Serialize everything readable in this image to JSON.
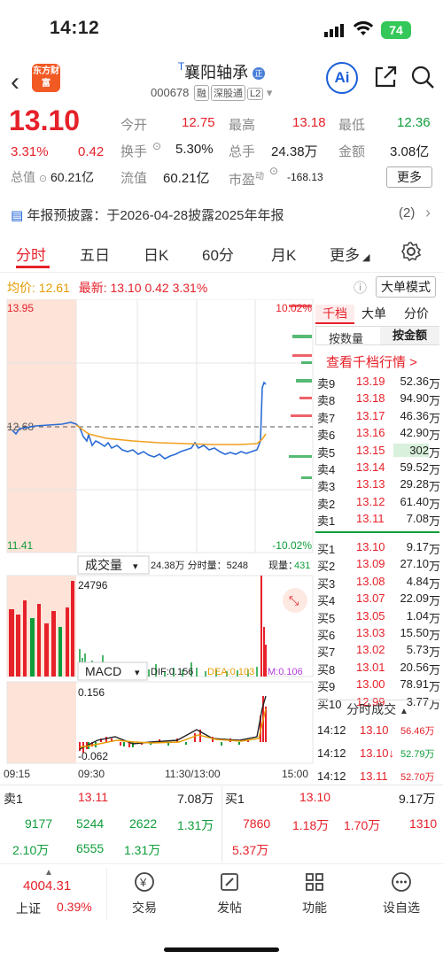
{
  "status": {
    "time": "14:12",
    "battery": "74"
  },
  "header": {
    "logo": "东方财富",
    "title": "襄阳轴承",
    "title_prefix": "T",
    "code": "000678",
    "tags": [
      "融",
      "深股通",
      "L2"
    ],
    "ai": "Ai"
  },
  "quote": {
    "price": "13.10",
    "pct": "3.31%",
    "chg": "0.42",
    "open_label": "今开",
    "open": "12.75",
    "high_label": "最高",
    "high": "13.18",
    "low_label": "最低",
    "low": "12.36",
    "turnover_label": "换手",
    "turnover": "5.30%",
    "vol_label": "总手",
    "vol": "24.38万",
    "amount_label": "金额",
    "amount": "3.08亿",
    "mcap_label": "总值",
    "mcap": "60.21亿",
    "float_label": "流值",
    "float": "60.21亿",
    "pe_label": "市盈",
    "pe_sup": "动",
    "pe": "-168.13",
    "more": "更多"
  },
  "notice": {
    "text": "年报预披露：于2026-04-28披露2025年年报",
    "count": "(2)"
  },
  "tabs": [
    "分时",
    "五日",
    "日K",
    "60分",
    "月K",
    "更多"
  ],
  "info": {
    "avg_label": "均价:",
    "avg": "12.61",
    "last_label": "最新:",
    "last": "13.10",
    "chg": "0.42",
    "pct": "3.31%",
    "big_order": "大单模式"
  },
  "chart": {
    "y_top": "13.95",
    "y_bottom": "11.41",
    "pct_top": "10.02%",
    "pct_bottom": "-10.02%",
    "ref": "12.68",
    "vol_label": "成交量",
    "vol_info": "24.38万 分时量：5248",
    "vol_now_label": "现量：",
    "vol_now": "431",
    "vol_max": "24796",
    "macd_label": "MACD",
    "dif": "DIF:0.156",
    "dea": "DEA:0.103",
    "m": "M:0.106",
    "macd_top": "0.156",
    "macd_bottom": "-0.062",
    "times": [
      "09:15",
      "09:30",
      "11:30/13:00",
      "15:00"
    ]
  },
  "orderbook": {
    "tabs": [
      "千档",
      "大单",
      "分价"
    ],
    "subtabs": [
      "按数量",
      "按金额"
    ],
    "link": "查看千档行情 >",
    "asks": [
      {
        "l": "卖9",
        "p": "13.19",
        "v": "52.36",
        "u": "万"
      },
      {
        "l": "卖8",
        "p": "13.18",
        "v": "94.90",
        "u": "万"
      },
      {
        "l": "卖7",
        "p": "13.17",
        "v": "46.36",
        "u": "万"
      },
      {
        "l": "卖6",
        "p": "13.16",
        "v": "42.90",
        "u": "万"
      },
      {
        "l": "卖5",
        "p": "13.15",
        "v": "302",
        "u": "万"
      },
      {
        "l": "卖4",
        "p": "13.14",
        "v": "59.52",
        "u": "万"
      },
      {
        "l": "卖3",
        "p": "13.13",
        "v": "29.28",
        "u": "万"
      },
      {
        "l": "卖2",
        "p": "13.12",
        "v": "61.40",
        "u": "万"
      },
      {
        "l": "卖1",
        "p": "13.11",
        "v": "7.08",
        "u": "万"
      }
    ],
    "bids": [
      {
        "l": "买1",
        "p": "13.10",
        "v": "9.17",
        "u": "万"
      },
      {
        "l": "买2",
        "p": "13.09",
        "v": "27.10",
        "u": "万"
      },
      {
        "l": "买3",
        "p": "13.08",
        "v": "4.84",
        "u": "万"
      },
      {
        "l": "买4",
        "p": "13.07",
        "v": "22.09",
        "u": "万"
      },
      {
        "l": "买5",
        "p": "13.05",
        "v": "1.04",
        "u": "万"
      },
      {
        "l": "买6",
        "p": "13.03",
        "v": "15.50",
        "u": "万"
      },
      {
        "l": "买7",
        "p": "13.02",
        "v": "5.73",
        "u": "万"
      },
      {
        "l": "买8",
        "p": "13.01",
        "v": "20.56",
        "u": "万"
      },
      {
        "l": "买9",
        "p": "13.00",
        "v": "78.91",
        "u": "万"
      },
      {
        "l": "买10",
        "p": "12.99",
        "v": "3.77",
        "u": "万"
      }
    ],
    "trades_title": "分时成交",
    "trades": [
      {
        "t": "14:12",
        "p": "13.10",
        "v": "56.46万"
      },
      {
        "t": "14:12",
        "p": "13.10↓",
        "v": "52.79万"
      },
      {
        "t": "14:12",
        "p": "13.11",
        "v": "52.70万"
      }
    ]
  },
  "depth": {
    "ask_label": "卖1",
    "ask_price": "13.11",
    "ask_vol": "7.08万",
    "bid_label": "买1",
    "bid_price": "13.10",
    "bid_vol": "9.17万",
    "left": [
      "9177",
      "5244",
      "2622",
      "1.31万",
      "2.10万",
      "6555",
      "1.31万"
    ],
    "right": [
      "7860",
      "1.18万",
      "1.70万",
      "1310",
      "5.37万"
    ]
  },
  "bottom": {
    "index": "4004.31",
    "index_name": "上证",
    "index_pct": "0.39%",
    "nav": [
      "交易",
      "发帖",
      "功能",
      "设自选"
    ]
  }
}
